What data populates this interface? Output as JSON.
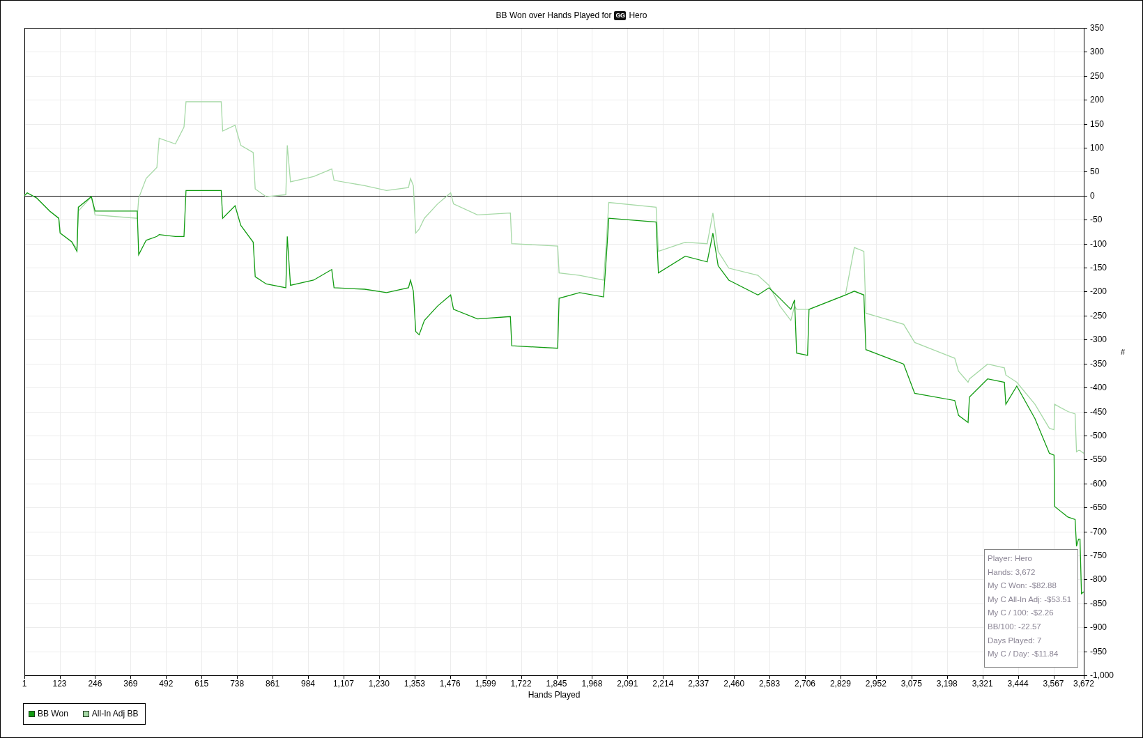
{
  "chart": {
    "title_logo": "GG",
    "title_player": "Hero",
    "chart_data": {
      "type": "line",
      "title": "BB Won over Hands Played for",
      "xlabel": "Hands Played",
      "ylabel": "#",
      "grid": true,
      "x": [
        1,
        11,
        44,
        89,
        120,
        125,
        165,
        183,
        188,
        233,
        246,
        392,
        397,
        423,
        460,
        468,
        524,
        554,
        561,
        683,
        688,
        731,
        751,
        794,
        801,
        839,
        907,
        912,
        923,
        1003,
        1066,
        1074,
        1180,
        1256,
        1332,
        1339,
        1349,
        1357,
        1369,
        1387,
        1433,
        1478,
        1488,
        1571,
        1685,
        1690,
        1849,
        1854,
        1925,
        2008,
        2018,
        2026,
        2190,
        2198,
        2291,
        2367,
        2387,
        2405,
        2442,
        2543,
        2581,
        2619,
        2657,
        2670,
        2677,
        2715,
        2720,
        2846,
        2877,
        2910,
        2917,
        3048,
        3086,
        3225,
        3238,
        3271,
        3276,
        3339,
        3397,
        3402,
        3440,
        3503,
        3553,
        3569,
        3571,
        3617,
        3642,
        3647,
        3654,
        3659,
        3664,
        3672
      ],
      "series": [
        {
          "name": "BB Won",
          "color": "#129c12",
          "values": [
            0,
            6,
            -5,
            -32,
            -47,
            -78,
            -96,
            -116,
            -24,
            -2,
            -32,
            -32,
            -123,
            -93,
            -85,
            -81,
            -85,
            -85,
            11,
            11,
            -47,
            -21,
            -62,
            -97,
            -169,
            -184,
            -192,
            -85,
            -187,
            -176,
            -154,
            -192,
            -195,
            -202,
            -192,
            -176,
            -199,
            -283,
            -290,
            -260,
            -230,
            -207,
            -237,
            -257,
            -252,
            -313,
            -318,
            -214,
            -202,
            -211,
            -123,
            -47,
            -55,
            -161,
            -126,
            -138,
            -78,
            -146,
            -176,
            -207,
            -192,
            -214,
            -237,
            -217,
            -328,
            -333,
            -237,
            -207,
            -199,
            -207,
            -321,
            -351,
            -412,
            -427,
            -458,
            -473,
            -420,
            -382,
            -389,
            -435,
            -397,
            -465,
            -537,
            -541,
            -648,
            -670,
            -675,
            -731,
            -716,
            -716,
            -830,
            -826
          ]
        },
        {
          "name": "All-In Adj BB",
          "color": "#a6d9a6",
          "values": [
            0,
            6,
            -5,
            -32,
            -47,
            -78,
            -96,
            -111,
            -32,
            -2,
            -40,
            -47,
            -5,
            36,
            59,
            120,
            108,
            143,
            196,
            196,
            135,
            147,
            105,
            90,
            14,
            -2,
            2,
            105,
            29,
            40,
            56,
            32,
            21,
            11,
            17,
            36,
            21,
            -78,
            -70,
            -47,
            -17,
            6,
            -17,
            -40,
            -36,
            -100,
            -105,
            -161,
            -166,
            -176,
            -93,
            -14,
            -24,
            -116,
            -97,
            -100,
            -36,
            -116,
            -151,
            -166,
            -187,
            -230,
            -260,
            -230,
            -237,
            -237,
            -237,
            -207,
            -108,
            -116,
            -245,
            -268,
            -306,
            -339,
            -366,
            -389,
            -382,
            -351,
            -359,
            -374,
            -389,
            -435,
            -485,
            -488,
            -435,
            -450,
            -455,
            -534,
            -531,
            -531,
            -534,
            -537
          ]
        }
      ],
      "xlim": [
        1,
        3672
      ],
      "ylim": [
        -1000,
        350
      ],
      "xticks": [
        1,
        123,
        246,
        369,
        492,
        615,
        738,
        861,
        984,
        {
          "value": 1107,
          "label": "1,107"
        },
        {
          "value": 1230,
          "label": "1,230"
        },
        {
          "value": 1353,
          "label": "1,353"
        },
        {
          "value": 1476,
          "label": "1,476"
        },
        {
          "value": 1599,
          "label": "1,599"
        },
        {
          "value": 1722,
          "label": "1,722"
        },
        {
          "value": 1845,
          "label": "1,845"
        },
        {
          "value": 1968,
          "label": "1,968"
        },
        {
          "value": 2091,
          "label": "2,091"
        },
        {
          "value": 2214,
          "label": "2,214"
        },
        {
          "value": 2337,
          "label": "2,337"
        },
        {
          "value": 2460,
          "label": "2,460"
        },
        {
          "value": 2583,
          "label": "2,583"
        },
        {
          "value": 2706,
          "label": "2,706"
        },
        {
          "value": 2829,
          "label": "2,829"
        },
        {
          "value": 2952,
          "label": "2,952"
        },
        {
          "value": 3075,
          "label": "3,075"
        },
        {
          "value": 3198,
          "label": "3,198"
        },
        {
          "value": 3321,
          "label": "3,321"
        },
        {
          "value": 3444,
          "label": "3,444"
        },
        {
          "value": 3567,
          "label": "3,567"
        },
        {
          "value": 3672,
          "label": "3,672"
        }
      ],
      "yticks": [
        350,
        300,
        250,
        200,
        150,
        100,
        50,
        0,
        -50,
        -100,
        -150,
        -200,
        -250,
        -300,
        -350,
        -400,
        -450,
        -500,
        -550,
        -600,
        -650,
        -700,
        -750,
        -800,
        -850,
        -900,
        -950,
        {
          "value": -1000,
          "label": "-1,000"
        }
      ]
    },
    "info_box": {
      "lines": [
        "Player: Hero",
        "Hands: 3,672",
        "My C Won: -$82.88",
        "My C All-In Adj: -$53.51",
        "My C / 100: -$2.26",
        "BB/100: -22.57",
        "Days Played: 7",
        "My C / Day: -$11.84"
      ]
    }
  }
}
